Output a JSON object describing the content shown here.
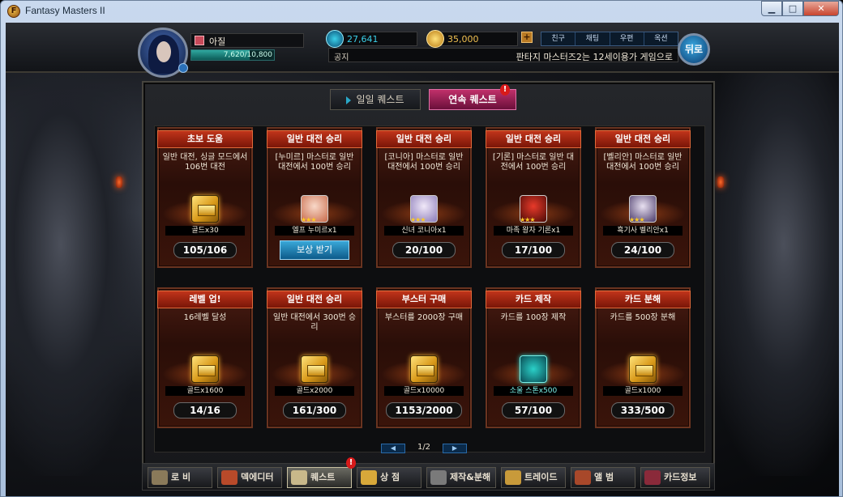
{
  "window": {
    "title": "Fantasy Masters II",
    "app_icon": "F",
    "minimize": "▁",
    "maximize": "□",
    "close": "✕"
  },
  "player": {
    "name": "아질",
    "exp_text": "7,620/10,800",
    "exp_progress": 0.7056
  },
  "resources": {
    "crystal": "27,641",
    "gold": "35,000",
    "gold_plus": "+"
  },
  "top_menu": [
    "친구",
    "채팅",
    "우편",
    "옥션"
  ],
  "notice": {
    "label": "공지",
    "text": "판타지 마스터즈2는 12세이용가 게임으로"
  },
  "back_button": "뒤로",
  "tabs": {
    "daily": "일일 퀘스트",
    "chain": "연속 퀘스트",
    "alert": "!"
  },
  "cards": [
    {
      "title": "초보 도움",
      "desc": "일반 대전, 싱글 모드에서 106번 대전",
      "reward_type": "gold",
      "reward": "골드x30",
      "progress": "105/106"
    },
    {
      "title": "일반 대전 승리",
      "desc": "[누미르] 마스터로 일반 대전에서 100번 승리",
      "reward_type": "card",
      "reward": "엘프 누미르x1",
      "stars": "★★★",
      "claim": "보상 받기"
    },
    {
      "title": "일반 대전 승리",
      "desc": "[코니아] 마스터로 일반 대전에서 100번 승리",
      "reward_type": "card",
      "reward": "신녀 코니아x1",
      "stars": "★★★",
      "progress": "20/100"
    },
    {
      "title": "일반 대전 승리",
      "desc": "[기론] 마스터로 일반 대전에서 100번 승리",
      "reward_type": "card",
      "reward": "마족 왕자 기론x1",
      "stars": "★★★",
      "progress": "17/100"
    },
    {
      "title": "일반 대전 승리",
      "desc": "[벨리안] 마스터로 일반 대전에서 100번 승리",
      "reward_type": "card",
      "reward": "흑기사 벨리안x1",
      "stars": "★★★",
      "progress": "24/100"
    },
    {
      "title": "레벨 업!",
      "desc": "16레벨 달성",
      "reward_type": "gold",
      "reward": "골드x1600",
      "progress": "14/16"
    },
    {
      "title": "일반 대전 승리",
      "desc": "일반 대전에서 300번 승리",
      "reward_type": "gold",
      "reward": "골드x2000",
      "progress": "161/300"
    },
    {
      "title": "부스터 구매",
      "desc": "부스터를 2000장 구매",
      "reward_type": "gold",
      "reward": "골드x10000",
      "progress": "1153/2000"
    },
    {
      "title": "카드 제작",
      "desc": "카드를 100장 제작",
      "reward_type": "soul",
      "reward": "소울 스톤x500",
      "progress": "57/100"
    },
    {
      "title": "카드 분해",
      "desc": "카드를 500장 분해",
      "reward_type": "gold",
      "reward": "골드x1000",
      "progress": "333/500"
    }
  ],
  "pager": {
    "text": "1/2",
    "prev": "◀",
    "next": "▶"
  },
  "bottom_nav": [
    {
      "label": "로 비",
      "icon": "lobby-icon"
    },
    {
      "label": "덱에디터",
      "icon": "deck-icon"
    },
    {
      "label": "퀘스트",
      "icon": "quest-icon",
      "alert": "!"
    },
    {
      "label": "상 점",
      "icon": "shop-icon"
    },
    {
      "label": "제작&분해",
      "icon": "craft-icon"
    },
    {
      "label": "트레이드",
      "icon": "trade-icon"
    },
    {
      "label": "앨 범",
      "icon": "album-icon"
    },
    {
      "label": "카드정보",
      "icon": "cardinfo-icon"
    }
  ],
  "colors": {
    "card_title": "#c0341a",
    "tab_active": "#c0306a",
    "gold": "#f0b030",
    "accent": "#2aa8c8"
  }
}
